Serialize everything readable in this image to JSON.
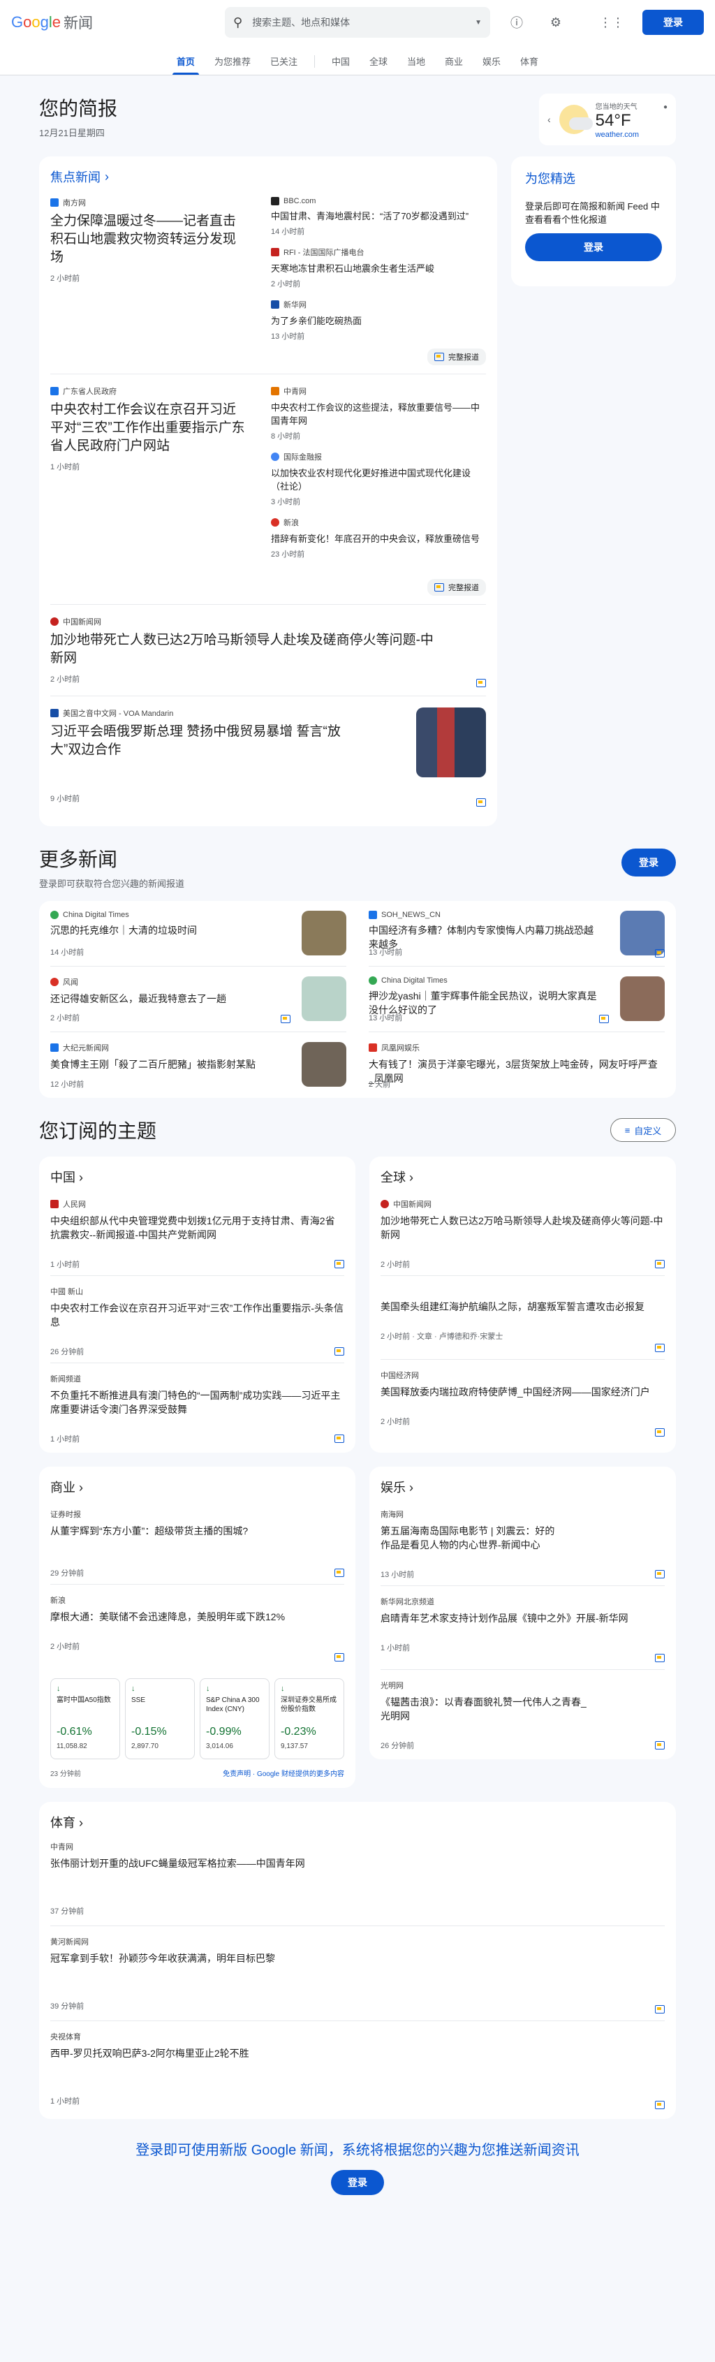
{
  "header": {
    "logo_letters": [
      "G",
      "o",
      "o",
      "g",
      "l",
      "e"
    ],
    "logo_suffix": "新闻",
    "search_placeholder": "搜索主题、地点和媒体",
    "signin": "登录"
  },
  "nav": [
    "首页",
    "为您推荐",
    "已关注",
    "中国",
    "全球",
    "当地",
    "商业",
    "娱乐",
    "体育"
  ],
  "briefing": {
    "title": "您的简报",
    "date": "12月21日星期四"
  },
  "weather": {
    "label": "您当地的天气",
    "temp": "54°F",
    "source": "weather.com"
  },
  "top_stories": {
    "title": "焦点新闻",
    "full_coverage": "完整报道",
    "clusters": [
      {
        "main": {
          "source": "南方网",
          "headline": "全力保障温暖过冬——记者直击积石山地震救灾物资转运分发现场",
          "time": "2 小时前"
        },
        "subs": [
          {
            "source": "BBC.com",
            "headline": "中国甘肃、青海地震村民：“活了70岁都没遇到过”",
            "time": "14 小时前"
          },
          {
            "source": "RFI - 法国国际广播电台",
            "headline": "天寒地冻甘肃积石山地震余生者生活严峻",
            "time": "2 小时前"
          },
          {
            "source": "新华网",
            "headline": "为了乡亲们能吃碗热面",
            "time": "13 小时前"
          }
        ]
      },
      {
        "main": {
          "source": "广东省人民政府",
          "headline": "中央农村工作会议在京召开习近平对“三农”工作作出重要指示广东省人民政府门户网站",
          "time": "1 小时前"
        },
        "subs": [
          {
            "source": "中青网",
            "headline": "中央农村工作会议的这些提法，释放重要信号——中国青年网",
            "time": "8 小时前"
          },
          {
            "source": "国际金融报",
            "headline": "以加快农业农村现代化更好推进中国式现代化建设（社论）",
            "time": "3 小时前"
          },
          {
            "source": "新浪",
            "headline": "措辞有新变化！年底召开的中央会议，释放重磅信号",
            "time": "23 小时前"
          }
        ]
      }
    ],
    "singles": [
      {
        "source": "中国新闻网",
        "headline": "加沙地带死亡人数已达2万哈马斯领导人赴埃及磋商停火等问题-中新网",
        "time": "2 小时前"
      },
      {
        "source": "美国之音中文网 - VOA Mandarin",
        "headline": "习近平会晤俄罗斯总理 赞扬中俄贸易暴增 誓言“放大”双边合作",
        "time": "9 小时前"
      }
    ]
  },
  "for_you": {
    "title": "为您精选",
    "text": "登录后即可在简报和新闻 Feed 中查看看看个性化报道",
    "button": "登录"
  },
  "more_news": {
    "title": "更多新闻",
    "subtitle": "登录即可获取符合您兴趣的新闻报道",
    "button": "登录",
    "items": [
      {
        "source": "China Digital Times",
        "headline": "沉思的托克维尔｜大清的垃圾时间",
        "time": "14 小时前",
        "thumb_color": "#8a7a5a"
      },
      {
        "source": "SOH_NEWS_CN",
        "headline": "中国经济有多糟？体制内专家懊悔人内幕刀挑战恐越来越多",
        "time": "13 小时前",
        "thumb_color": "#5b7bb3"
      },
      {
        "source": "风闻",
        "headline": "还记得雄安新区么，最近我特意去了一趟",
        "time": "2 小时前",
        "thumb_color": "#b9d3c9"
      },
      {
        "source": "China Digital Times",
        "headline": "押沙龙yashi｜董宇辉事件能全民热议，说明大家真是没什么好议的了",
        "time": "13 小时前",
        "thumb_color": "#8b6b5a"
      },
      {
        "source": "大纪元新闻网",
        "headline": "美食博主王刚「殺了二百斤肥豬」被指影射某點",
        "time": "12 小时前",
        "thumb_color": "#6f6458"
      },
      {
        "source": "凤凰网娱乐",
        "headline": "大有钱了！演员于洋豪宅曝光，3层货架放上吨金砖，网友吁呼严查_凤凰网",
        "time": "2 天前",
        "thumb_color": ""
      }
    ]
  },
  "topics": {
    "title": "您订阅的主题",
    "customize": "自定义",
    "china": {
      "title": "中国",
      "items": [
        {
          "source": "人民网",
          "headline": "中央组织部从代中央管理党费中划拨1亿元用于支持甘肃、青海2省抗震救灾--新闻报道-中国共产党新闻网",
          "time": "1 小时前"
        },
        {
          "source": "中國 新山",
          "headline": "中央农村工作会议在京召开习近平对“三农”工作作出重要指示-头条信息",
          "time": "26 分钟前"
        },
        {
          "source": "新闻频道",
          "headline": "不负重托不断推进具有澳门特色的“一国两制”成功实践——习近平主席重要讲话令澳门各界深受鼓舞",
          "time": "1 小时前"
        }
      ]
    },
    "world": {
      "title": "全球",
      "items": [
        {
          "source": "中国新闻网",
          "headline": "加沙地带死亡人数已达2万哈马斯领导人赴埃及磋商停火等问题-中新网",
          "time": "2 小时前"
        },
        {
          "source": "",
          "headline": "美国牵头组建红海护航编队之际，胡塞叛军誓言遭攻击必报复",
          "time": "2 小时前 · 文章 · 卢博德和乔·宋蒙士"
        },
        {
          "source": "中国经济网",
          "headline": "美国释放委内瑞拉政府特使萨博_中国经济网——国家经济门户",
          "time": "2 小时前"
        }
      ]
    },
    "business": {
      "title": "商业",
      "items": [
        {
          "source": "证券时报",
          "headline": "从董宇辉到“东方小董”：超级带货主播的围城?",
          "time": "29 分钟前"
        },
        {
          "source": "新浪",
          "headline": "摩根大通：美联储不会迅速降息，美股明年或下跌12%",
          "time": "2 小时前"
        }
      ],
      "stocks": [
        {
          "name": "富时中国A50指数",
          "change": "-0.61%",
          "value": "11,058.82"
        },
        {
          "name": "SSE",
          "change": "-0.15%",
          "value": "2,897.70"
        },
        {
          "name": "S&P China A 300 Index (CNY)",
          "change": "-0.99%",
          "value": "3,014.06"
        },
        {
          "name": "深圳证券交易所成份股价指数",
          "change": "-0.23%",
          "value": "9,137.57"
        }
      ],
      "stock_time": "23 分钟前",
      "stock_disclaimer": "免责声明 · Google 财经提供的更多内容",
      "stock_color": "#137333"
    },
    "ent": {
      "title": "娱乐",
      "items": [
        {
          "source": "南海网",
          "headline": "第五届海南岛国际电影节 | 刘震云：好的作品是看见人物的内心世界-新闻中心",
          "time": "13 小时前"
        },
        {
          "source": "新华网北京频道",
          "headline": "启晴青年艺术家支持计划作品展《镜中之外》开展-新华网",
          "time": "1 小时前"
        },
        {
          "source": "光明网",
          "headline": "《韫茜击浪》：以青春面貌礼赞一代伟人之青春_光明网",
          "time": "26 分钟前"
        }
      ]
    },
    "sports": {
      "title": "体育",
      "items": [
        {
          "source": "中青网",
          "headline": "张伟丽计划开重的战UFC蝇量级冠军格拉索——中国青年网",
          "time": "37 分钟前"
        },
        {
          "source": "黄河新闻网",
          "headline": "冠军拿到手软！孙颖莎今年收获满满，明年目标巴黎",
          "time": "39 分钟前"
        },
        {
          "source": "央视体育",
          "headline": "西甲-罗贝托双响巴萨3-2阿尔梅里亚止2轮不胜",
          "time": "1 小时前"
        }
      ]
    }
  },
  "footer": {
    "cta": "登录即可使用新版 Google 新闻，系统将根据您的兴趣为您推送新闻资讯",
    "button": "登录"
  }
}
